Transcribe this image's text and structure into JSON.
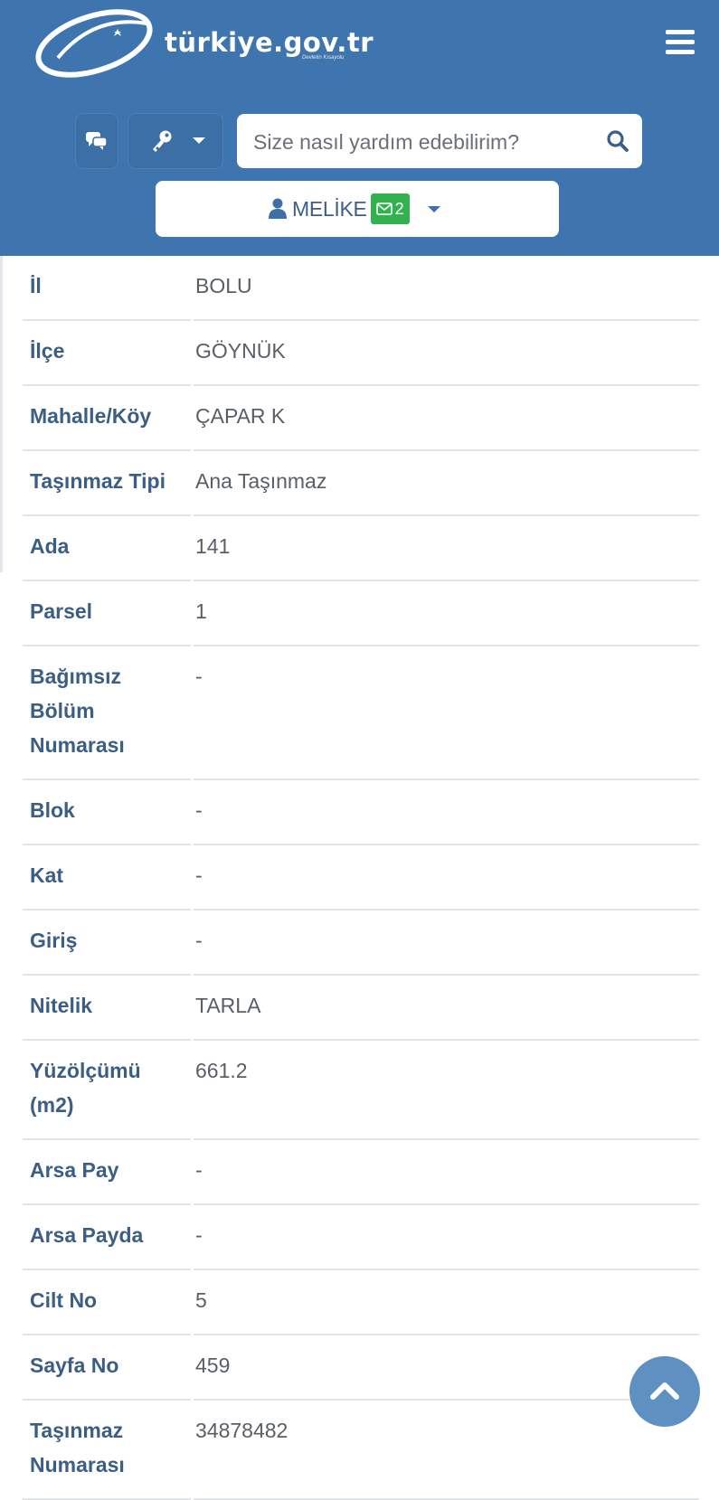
{
  "header": {
    "brand": "türkiye.gov.tr",
    "tagline": "Devletin Kısayolu",
    "search_placeholder": "Size nasıl yardım edebilirim?",
    "user_name": "MELİKE",
    "message_count": "2",
    "colors": {
      "header_bg": "#3f75ae",
      "badge_green": "#33b14e",
      "label_blue": "#3b5e85"
    }
  },
  "details": [
    {
      "key": "İl",
      "value": "BOLU"
    },
    {
      "key": "İlçe",
      "value": "GÖYNÜK"
    },
    {
      "key": "Mahalle/Köy",
      "value": "ÇAPAR K"
    },
    {
      "key": "Taşınmaz Tipi",
      "value": "Ana Taşınmaz"
    },
    {
      "key": "Ada",
      "value": "141"
    },
    {
      "key": "Parsel",
      "value": "1"
    },
    {
      "key": "Bağımsız Bölüm Numarası",
      "value": "-"
    },
    {
      "key": "Blok",
      "value": "-"
    },
    {
      "key": "Kat",
      "value": "-"
    },
    {
      "key": "Giriş",
      "value": "-"
    },
    {
      "key": "Nitelik",
      "value": "TARLA"
    },
    {
      "key": "Yüzölçümü (m2)",
      "value": "661.2"
    },
    {
      "key": "Arsa Pay",
      "value": "-"
    },
    {
      "key": "Arsa Payda",
      "value": "-"
    },
    {
      "key": "Cilt No",
      "value": "5"
    },
    {
      "key": "Sayfa No",
      "value": "459"
    },
    {
      "key": "Taşınmaz Numarası",
      "value": "34878482"
    }
  ],
  "icons": {
    "chat": "chat-icon",
    "key": "key-icon",
    "search": "search-icon",
    "user": "user-icon",
    "mail": "envelope-icon",
    "menu": "hamburger-menu-icon",
    "scroll_top": "chevron-up-icon"
  }
}
